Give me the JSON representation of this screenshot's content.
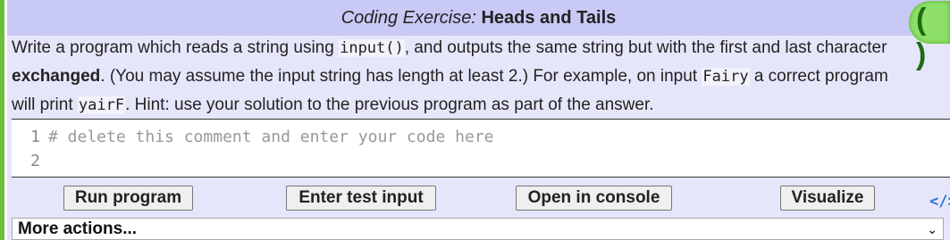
{
  "title": {
    "prefix": "Coding Exercise:",
    "name": "Heads and Tails"
  },
  "description": {
    "p1": "Write a program which reads a string using ",
    "code1": "input()",
    "p2": ", and outputs the same string but with the first and last character ",
    "bold1": "exchanged",
    "p3": ". (You may assume the input string has length at least 2.) For example, on input ",
    "code2": "Fairy",
    "p4": " a correct program will print ",
    "code3": "yairF",
    "p5": ". Hint: use your solution to the previous program as part of the answer."
  },
  "editor": {
    "line_numbers": [
      "1",
      "2"
    ],
    "lines": [
      "# delete this comment and enter your code here",
      ""
    ]
  },
  "buttons": {
    "run": "Run program",
    "test_input": "Enter test input",
    "console": "Open in console",
    "visualize": "Visualize"
  },
  "embed_icon": "</>",
  "more_actions": {
    "selected": "More actions..."
  },
  "status_badge": {
    "text": "( )",
    "color": "#8ee06a"
  },
  "colors": {
    "title_bar": "#c9c9f6",
    "panel": "#e6e6fb",
    "stripe": "#6bbf3a",
    "link": "#2a6fd6"
  },
  "icons": {
    "embed": "code-embed-icon",
    "dropdown": "chevron-down-icon"
  }
}
